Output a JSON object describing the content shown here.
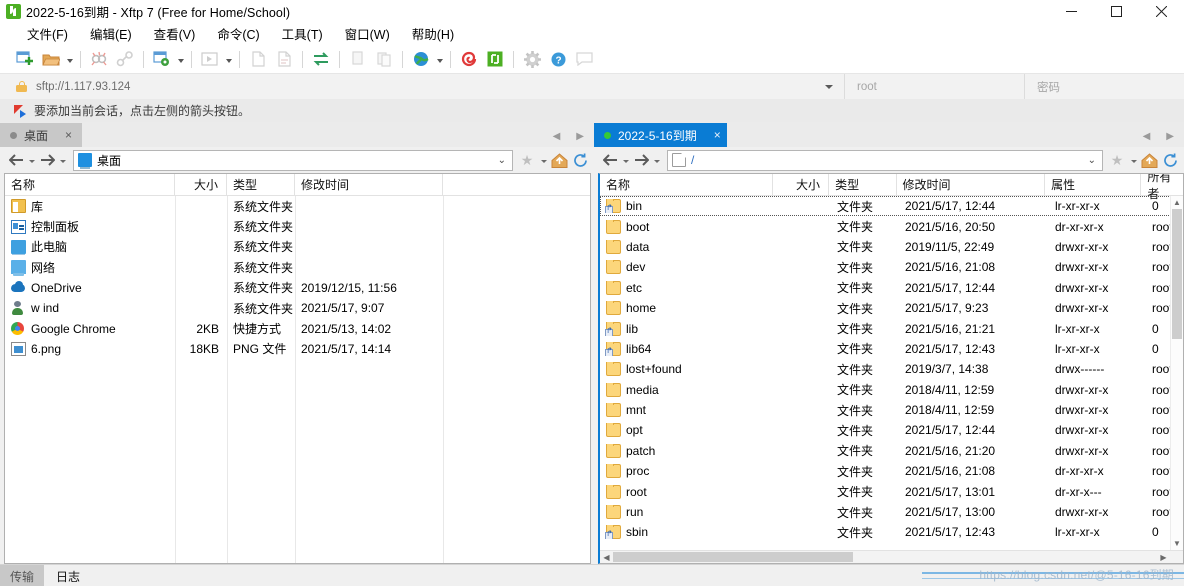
{
  "window": {
    "title": "2022-5-16到期 - Xftp 7 (Free for Home/School)",
    "app_icon": "xftp-icon",
    "minimize": "—",
    "maximize": "▢",
    "close": "✕"
  },
  "menubar": [
    {
      "label": "文件(F)",
      "name": "menu-file"
    },
    {
      "label": "编辑(E)",
      "name": "menu-edit"
    },
    {
      "label": "查看(V)",
      "name": "menu-view"
    },
    {
      "label": "命令(C)",
      "name": "menu-command"
    },
    {
      "label": "工具(T)",
      "name": "menu-tools"
    },
    {
      "label": "窗口(W)",
      "name": "menu-window"
    },
    {
      "label": "帮助(H)",
      "name": "menu-help"
    }
  ],
  "toolbar": {
    "buttons": [
      "new-session-icon",
      "open-folder-icon",
      "dropdown-arrow",
      "separator",
      "disconnect-icon",
      "link-icon",
      "separator",
      "session-properties-icon",
      "dropdown-arrow",
      "separator",
      "transfer-window-icon",
      "dropdown-arrow",
      "separator",
      "new-file-icon",
      "edit-file-icon",
      "separator",
      "sync-browse-icon",
      "separator",
      "copy-icon",
      "paste-icon",
      "separator",
      "globe-icon",
      "dropdown-arrow",
      "separator",
      "xshell-icon",
      "xftp-icon",
      "separator",
      "settings-gear-icon",
      "help-icon",
      "feedback-icon"
    ]
  },
  "address_bar": {
    "lock_icon": "lock-icon",
    "url": "sftp://1.117.93.124",
    "dropdown_icon": "chevron-down-icon",
    "username": "root",
    "password_placeholder": "密码"
  },
  "notice": {
    "icon": "flag-icon",
    "text": "要添加当前会话，点击左侧的箭头按钮。"
  },
  "left_pane": {
    "tab": {
      "label": "桌面",
      "dot": "status-dot-idle",
      "close": "×"
    },
    "nav": {
      "back_icon": "arrow-left-icon",
      "forward_icon": "arrow-right-icon",
      "path_icon": "desktop-icon",
      "path": "桌面",
      "caret": "chevron-down-icon",
      "star_icon": "star-icon",
      "home_icon": "home-icon",
      "refresh_icon": "refresh-icon"
    },
    "columns": [
      {
        "label": "名称",
        "width": 170
      },
      {
        "label": "大小",
        "width": 52,
        "align": "right"
      },
      {
        "label": "类型",
        "width": 68
      },
      {
        "label": "修改时间",
        "width": 148
      }
    ],
    "rows": [
      {
        "icon": "library-icon",
        "name": "库",
        "size": "",
        "type": "系统文件夹",
        "modified": ""
      },
      {
        "icon": "control-panel-icon",
        "name": "控制面板",
        "size": "",
        "type": "系统文件夹",
        "modified": ""
      },
      {
        "icon": "this-pc-icon",
        "name": "此电脑",
        "size": "",
        "type": "系统文件夹",
        "modified": ""
      },
      {
        "icon": "network-icon",
        "name": "网络",
        "size": "",
        "type": "系统文件夹",
        "modified": ""
      },
      {
        "icon": "onedrive-icon",
        "name": "OneDrive",
        "size": "",
        "type": "系统文件夹",
        "modified": "2019/12/15, 11:56"
      },
      {
        "icon": "user-icon",
        "name": "w ind",
        "size": "",
        "type": "系统文件夹",
        "modified": "2021/5/17, 9:07"
      },
      {
        "icon": "chrome-icon",
        "name": "Google Chrome",
        "size": "2KB",
        "type": "快捷方式",
        "modified": "2021/5/13, 14:02"
      },
      {
        "icon": "png-file-icon",
        "name": "6.png",
        "size": "18KB",
        "type": "PNG 文件",
        "modified": "2021/5/17, 14:14"
      }
    ]
  },
  "right_pane": {
    "tab": {
      "label": "2022-5-16到期",
      "dot": "status-dot-connected",
      "close": "×"
    },
    "nav": {
      "back_icon": "arrow-left-icon",
      "forward_icon": "arrow-right-icon",
      "path_icon": "file-icon",
      "path": "/",
      "caret": "chevron-down-icon",
      "star_icon": "star-icon",
      "home_icon": "home-icon",
      "refresh_icon": "refresh-icon"
    },
    "columns": [
      {
        "label": "名称",
        "width": 175
      },
      {
        "label": "大小",
        "width": 56,
        "align": "right"
      },
      {
        "label": "类型",
        "width": 68
      },
      {
        "label": "修改时间",
        "width": 150
      },
      {
        "label": "属性",
        "width": 97
      },
      {
        "label": "所有者",
        "width": 70
      }
    ],
    "rows": [
      {
        "icon": "folder-link-icon",
        "name": "bin",
        "size": "",
        "type": "文件夹",
        "modified": "2021/5/17, 12:44",
        "attrs": "lr-xr-xr-x",
        "owner": "0",
        "focused": true
      },
      {
        "icon": "folder-icon",
        "name": "boot",
        "size": "",
        "type": "文件夹",
        "modified": "2021/5/16, 20:50",
        "attrs": "dr-xr-xr-x",
        "owner": "root"
      },
      {
        "icon": "folder-icon",
        "name": "data",
        "size": "",
        "type": "文件夹",
        "modified": "2019/11/5, 22:49",
        "attrs": "drwxr-xr-x",
        "owner": "root"
      },
      {
        "icon": "folder-icon",
        "name": "dev",
        "size": "",
        "type": "文件夹",
        "modified": "2021/5/16, 21:08",
        "attrs": "drwxr-xr-x",
        "owner": "root"
      },
      {
        "icon": "folder-icon",
        "name": "etc",
        "size": "",
        "type": "文件夹",
        "modified": "2021/5/17, 12:44",
        "attrs": "drwxr-xr-x",
        "owner": "root"
      },
      {
        "icon": "folder-icon",
        "name": "home",
        "size": "",
        "type": "文件夹",
        "modified": "2021/5/17, 9:23",
        "attrs": "drwxr-xr-x",
        "owner": "root"
      },
      {
        "icon": "folder-link-icon",
        "name": "lib",
        "size": "",
        "type": "文件夹",
        "modified": "2021/5/16, 21:21",
        "attrs": "lr-xr-xr-x",
        "owner": "0"
      },
      {
        "icon": "folder-link-icon",
        "name": "lib64",
        "size": "",
        "type": "文件夹",
        "modified": "2021/5/17, 12:43",
        "attrs": "lr-xr-xr-x",
        "owner": "0"
      },
      {
        "icon": "folder-icon",
        "name": "lost+found",
        "size": "",
        "type": "文件夹",
        "modified": "2019/3/7, 14:38",
        "attrs": "drwx------",
        "owner": "root"
      },
      {
        "icon": "folder-icon",
        "name": "media",
        "size": "",
        "type": "文件夹",
        "modified": "2018/4/11, 12:59",
        "attrs": "drwxr-xr-x",
        "owner": "root"
      },
      {
        "icon": "folder-icon",
        "name": "mnt",
        "size": "",
        "type": "文件夹",
        "modified": "2018/4/11, 12:59",
        "attrs": "drwxr-xr-x",
        "owner": "root"
      },
      {
        "icon": "folder-icon",
        "name": "opt",
        "size": "",
        "type": "文件夹",
        "modified": "2021/5/17, 12:44",
        "attrs": "drwxr-xr-x",
        "owner": "root"
      },
      {
        "icon": "folder-icon",
        "name": "patch",
        "size": "",
        "type": "文件夹",
        "modified": "2021/5/16, 21:20",
        "attrs": "drwxr-xr-x",
        "owner": "root"
      },
      {
        "icon": "folder-icon",
        "name": "proc",
        "size": "",
        "type": "文件夹",
        "modified": "2021/5/16, 21:08",
        "attrs": "dr-xr-xr-x",
        "owner": "root"
      },
      {
        "icon": "folder-icon",
        "name": "root",
        "size": "",
        "type": "文件夹",
        "modified": "2021/5/17, 13:01",
        "attrs": "dr-xr-x---",
        "owner": "root"
      },
      {
        "icon": "folder-icon",
        "name": "run",
        "size": "",
        "type": "文件夹",
        "modified": "2021/5/17, 13:00",
        "attrs": "drwxr-xr-x",
        "owner": "root"
      },
      {
        "icon": "folder-link-icon",
        "name": "sbin",
        "size": "",
        "type": "文件夹",
        "modified": "2021/5/17, 12:43",
        "attrs": "lr-xr-xr-x",
        "owner": "0"
      }
    ]
  },
  "bottom": {
    "tabs": [
      {
        "label": "传输",
        "name": "bottom-tab-transfer"
      },
      {
        "label": "日志",
        "name": "bottom-tab-log"
      }
    ]
  },
  "watermark": "https://blog.csdn.net/@5-16-16到期"
}
